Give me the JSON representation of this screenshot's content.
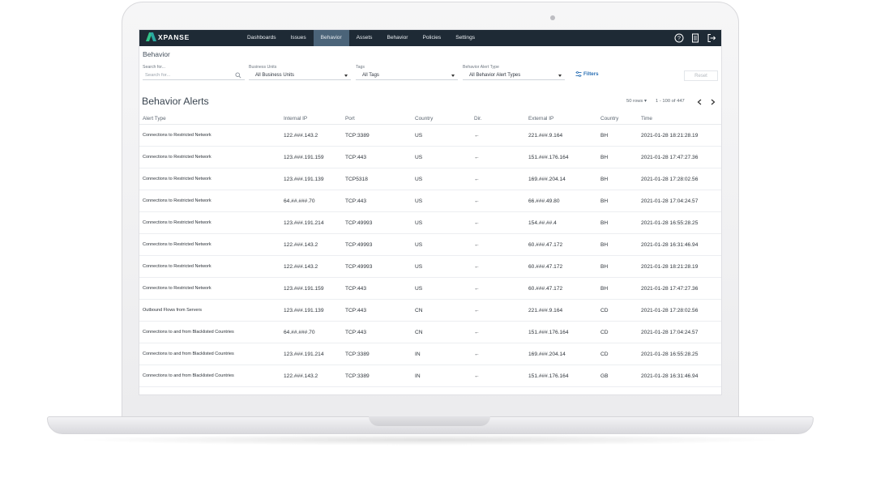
{
  "nav": {
    "logo": "XPANSE",
    "items": [
      "Dashboards",
      "Issues",
      "Behavior",
      "Assets",
      "Behavior",
      "Policies",
      "Settings"
    ],
    "active_index": 2
  },
  "page_title": "Behavior",
  "filters": {
    "search_label": "Search for...",
    "search_placeholder": "Search for...",
    "business_units_label": "Business Units",
    "business_units_value": "All Business Units",
    "tags_label": "Tags",
    "tags_value": "All Tags",
    "alert_type_label": "Behavior Alert Type",
    "alert_type_value": "All Behavior Alert Types",
    "filters_button": "Filters",
    "reset_button": "Reset"
  },
  "alerts": {
    "title": "Behavior Alerts",
    "rows_per_page": "50 rows",
    "range": "1 - 100 of 447",
    "columns": [
      "Alert Type",
      "Internal IP",
      "Port",
      "Country",
      "Dir.",
      "External IP",
      "Country",
      "Time"
    ],
    "rows": [
      [
        "Connections to Restricted Network",
        "122.###.143.2",
        "TCP:3389",
        "US",
        "←",
        "221.###.9.164",
        "BH",
        "2021-01-28 18:21:28.19"
      ],
      [
        "Connections to Restricted Network",
        "123.###.191.159",
        "TCP:443",
        "US",
        "←",
        "151.###.176.164",
        "BH",
        "2021-01-28 17:47:27.36"
      ],
      [
        "Connections to Restricted Network",
        "123.###.191.139",
        "TCP5318",
        "US",
        "←",
        "169.###.204.14",
        "BH",
        "2021-01-28 17:28:02.56"
      ],
      [
        "Connections to Restricted Network",
        "64.##.###.70",
        "TCP:443",
        "US",
        "←",
        "66.###.49.80",
        "BH",
        "2021-01-28 17:04:24.57"
      ],
      [
        "Connections to Restricted Network",
        "123.###.191.214",
        "TCP:49993",
        "US",
        "←",
        "154.##.##.4",
        "BH",
        "2021-01-28 16:55:28.25"
      ],
      [
        "Connections to Restricted Network",
        "122.###.143.2",
        "TCP:49993",
        "US",
        "←",
        "60.###.47.172",
        "BH",
        "2021-01-28 16:31:46.94"
      ],
      [
        "Connections to Restricted Network",
        "122.###.143.2",
        "TCP:49993",
        "US",
        "←",
        "60.###.47.172",
        "BH",
        "2021-01-28 18:21:28.19"
      ],
      [
        "Connections to Restricted Network",
        "123.###.191.159",
        "TCP:443",
        "US",
        "←",
        "60.###.47.172",
        "BH",
        "2021-01-28 17:47:27.36"
      ],
      [
        "Outbound Flows from Servers",
        "123.###.191.139",
        "TCP:443",
        "CN",
        "←",
        "221.###.9.164",
        "CD",
        "2021-01-28 17:28:02.56"
      ],
      [
        "Connections to and from Blacklisted Countries",
        "64.##.###.70",
        "TCP:443",
        "CN",
        "←",
        "151.###.176.164",
        "CD",
        "2021-01-28 17:04:24.57"
      ],
      [
        "Connections to and from Blacklisted Countries",
        "123.###.191.214",
        "TCP:3389",
        "IN",
        "←",
        "169.###.204.14",
        "CD",
        "2021-01-28 16:55:28.25"
      ],
      [
        "Connections to and from Blacklisted Countries",
        "122.###.143.2",
        "TCP:3389",
        "IN",
        "←",
        "151.###.176.164",
        "GB",
        "2021-01-28 16:31:46.94"
      ]
    ]
  },
  "colors": {
    "nav_bg": "#1e2a35",
    "nav_active": "#4b6479",
    "accent": "#2a6fb4",
    "logo_green": "#33c48a"
  },
  "icons": [
    "help-icon",
    "document-icon",
    "logout-icon",
    "search-icon",
    "filter-icon",
    "chevron-left-icon",
    "chevron-right-icon"
  ]
}
